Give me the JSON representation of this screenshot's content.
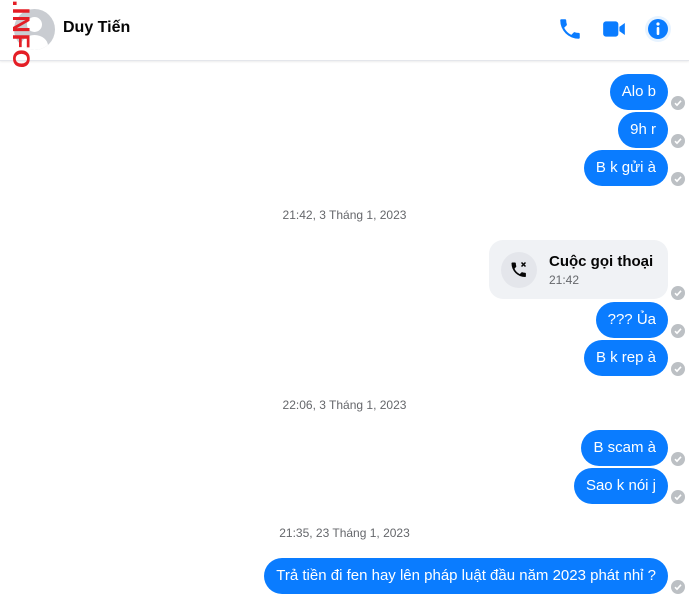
{
  "header": {
    "contact_name": "Duy Tiến",
    "watermark": ".INFO",
    "accent_color": "#0a7cff",
    "icons": [
      "phone-icon",
      "video-camera-icon",
      "info-icon"
    ]
  },
  "messages": [
    {
      "text": "Alo b"
    },
    {
      "text": "9h r"
    },
    {
      "text": "B k gửi à"
    },
    {
      "timestamp": "21:42, 3 Tháng 1, 2023"
    },
    {
      "call_title": "Cuộc gọi thoại",
      "call_time": "21:42"
    },
    {
      "text": "??? Ủa"
    },
    {
      "text": "B k rep à"
    },
    {
      "timestamp": "22:06, 3 Tháng 1, 2023"
    },
    {
      "text": "B scam à"
    },
    {
      "text": "Sao k nói j"
    },
    {
      "timestamp": "21:35, 23 Tháng 1, 2023"
    },
    {
      "text": "Trả tiền đi fen hay lên pháp luật đầu năm 2023 phát nhỉ  ?"
    }
  ]
}
